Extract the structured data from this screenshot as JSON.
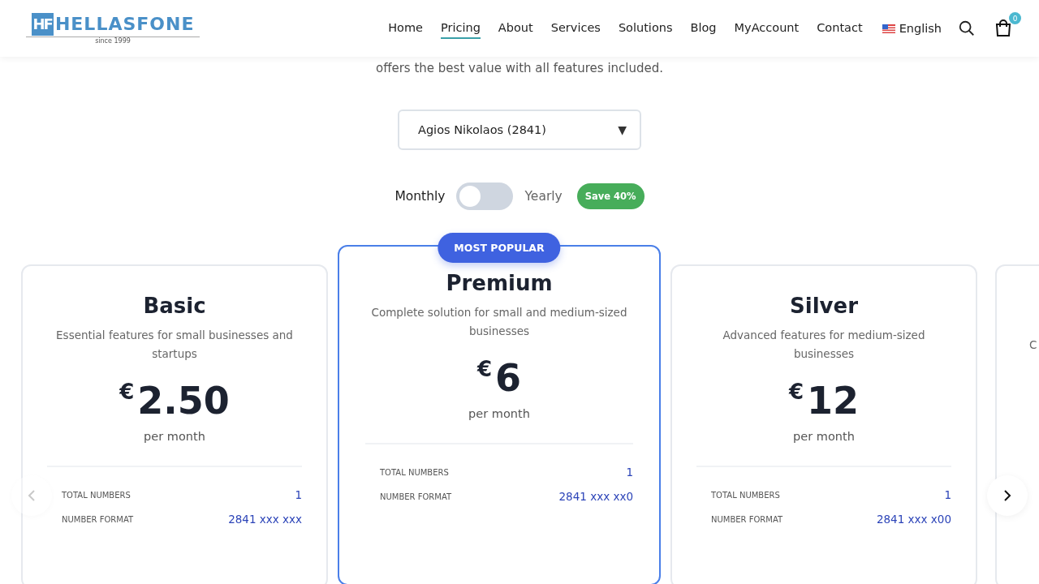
{
  "header": {
    "logo": {
      "mark": "HF",
      "name": "HELLASFONE",
      "tagline": "since 1999"
    },
    "nav": [
      {
        "label": "Home",
        "selected": false
      },
      {
        "label": "Pricing",
        "selected": true
      },
      {
        "label": "About",
        "selected": false
      },
      {
        "label": "Services",
        "selected": false
      },
      {
        "label": "Solutions",
        "selected": false
      },
      {
        "label": "Blog",
        "selected": false
      },
      {
        "label": "MyAccount",
        "selected": false
      },
      {
        "label": "Contact",
        "selected": false
      }
    ],
    "language": "English",
    "cart_count": "0"
  },
  "intro": "offers the best value with all features included.",
  "area_select": {
    "value": "Agios Nikolaos (2841)",
    "caret": "▼"
  },
  "billing": {
    "monthly_label": "Monthly",
    "yearly_label": "Yearly",
    "yearly": false,
    "save_badge": "Save 40%"
  },
  "carousel": {
    "prev_disabled": true,
    "next_disabled": false
  },
  "plans": [
    {
      "name": "Basic",
      "description": "Essential features for small businesses and startups",
      "currency": "€",
      "price": "2.50",
      "period": "per month",
      "features": [
        {
          "label": "TOTAL NUMBERS",
          "value": "1"
        },
        {
          "label": "NUMBER FORMAT",
          "value": "2841 xxx xxx"
        }
      ]
    },
    {
      "name": "Premium",
      "badge": "MOST POPULAR",
      "description": "Complete solution for small and medium-sized businesses",
      "currency": "€",
      "price": "6",
      "period": "per month",
      "features": [
        {
          "label": "TOTAL NUMBERS",
          "value": "1"
        },
        {
          "label": "NUMBER FORMAT",
          "value": "2841 xxx xx0"
        }
      ]
    },
    {
      "name": "Silver",
      "description": "Advanced features for medium-sized businesses",
      "currency": "€",
      "price": "12",
      "period": "per month",
      "features": [
        {
          "label": "TOTAL NUMBERS",
          "value": "1"
        },
        {
          "label": "NUMBER FORMAT",
          "value": "2841 xxx x00"
        }
      ]
    }
  ],
  "peek_card": {
    "description": "C"
  }
}
